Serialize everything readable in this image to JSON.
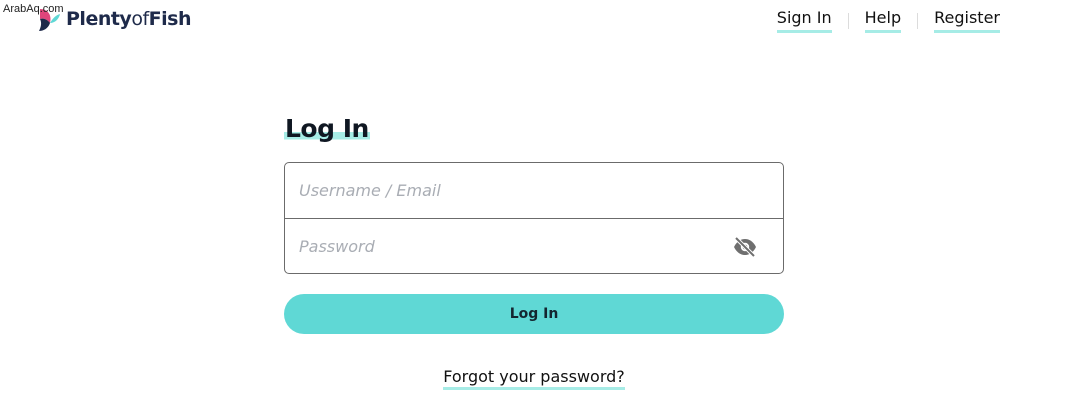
{
  "watermark": "ArabAq.com",
  "brand": {
    "name_part1": "Plenty",
    "name_part2": "of",
    "name_part3": "Fish",
    "logo_icon": "fish-logo-icon",
    "colors": {
      "pink": "#e0457b",
      "navy": "#1e2a4a",
      "teal": "#5fd8d5"
    }
  },
  "nav": {
    "sign_in": "Sign In",
    "help": "Help",
    "register": "Register"
  },
  "login": {
    "title": "Log In",
    "username_placeholder": "Username / Email",
    "password_placeholder": "Password",
    "password_toggle_icon": "eye-slash-icon",
    "submit_label": "Log In",
    "forgot_link": "Forgot your password?"
  },
  "colors": {
    "accent": "#5fd8d5",
    "underline": "#a6ece6",
    "border": "#6b6b6b",
    "placeholder": "#a9adb4"
  }
}
